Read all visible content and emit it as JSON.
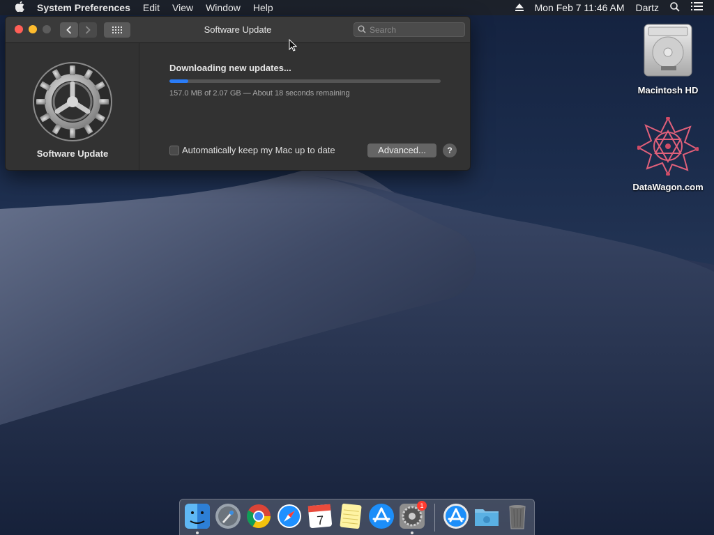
{
  "menubar": {
    "app_name": "System Preferences",
    "items": [
      {
        "label": "Edit"
      },
      {
        "label": "View"
      },
      {
        "label": "Window"
      },
      {
        "label": "Help"
      }
    ],
    "datetime": "Mon Feb 7  11:46 AM",
    "user": "Dartz"
  },
  "window": {
    "title": "Software Update",
    "search_placeholder": "Search",
    "pane_label": "Software Update",
    "status_title": "Downloading new updates...",
    "progress_fraction": 0.07,
    "progress_detail": "157.0 MB of 2.07 GB — About 18 seconds remaining",
    "auto_update_label": "Automatically keep my Mac up to date",
    "auto_update_checked": false,
    "advanced_label": "Advanced...",
    "help_label": "?"
  },
  "desktop": {
    "icons": [
      {
        "label": "Macintosh HD"
      },
      {
        "label": "DataWagon.com"
      }
    ]
  },
  "dock": {
    "badge": "1",
    "items": [
      "finder-icon",
      "launchpad-icon",
      "chrome-icon",
      "safari-icon",
      "calendar-icon",
      "notes-icon",
      "app-store-icon",
      "system-preferences-icon",
      "downloads-stack-icon",
      "folder-icon",
      "trash-icon"
    ]
  },
  "colors": {
    "accent": "#2a7cf7",
    "close": "#ff5f57",
    "minimize": "#febc2e"
  }
}
